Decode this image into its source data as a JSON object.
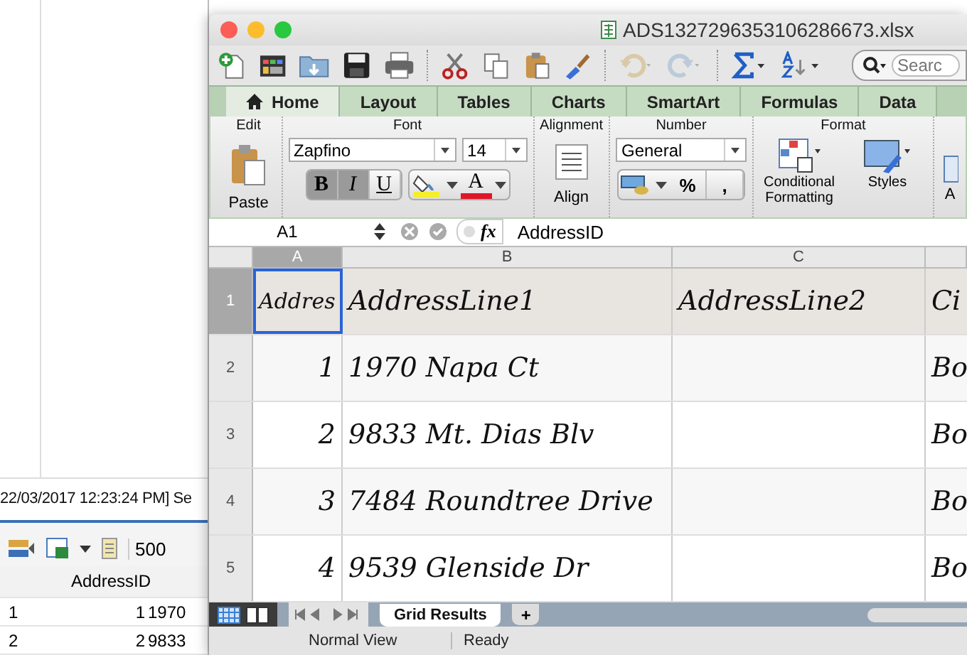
{
  "background_app": {
    "log_line": "22/03/2017 12:23:24 PM] Se",
    "toolbar_count": "500",
    "grid": {
      "columns": [
        "",
        "AddressID"
      ],
      "rows": [
        [
          "1",
          "1",
          "1970"
        ],
        [
          "2",
          "2",
          "9833"
        ]
      ]
    }
  },
  "window": {
    "title": "ADS1327296353106286673.xlsx"
  },
  "search": {
    "placeholder": "Searc"
  },
  "tabs": [
    {
      "label": "Home",
      "selected": true
    },
    {
      "label": "Layout",
      "selected": false
    },
    {
      "label": "Tables",
      "selected": false
    },
    {
      "label": "Charts",
      "selected": false
    },
    {
      "label": "SmartArt",
      "selected": false
    },
    {
      "label": "Formulas",
      "selected": false
    },
    {
      "label": "Data",
      "selected": false
    }
  ],
  "ribbon": {
    "groups": [
      "Edit",
      "Font",
      "Alignment",
      "Number",
      "Format"
    ],
    "paste": "Paste",
    "font_name": "Zapfino",
    "font_size": "14",
    "bold": {
      "label": "B",
      "on": true
    },
    "italic": {
      "label": "I",
      "on": true
    },
    "underline": {
      "label": "U",
      "on": false
    },
    "font_color_letter": "A",
    "align": "Align",
    "number_format": "General",
    "percent": "%",
    "comma": ",",
    "conditional": "Conditional Formatting",
    "styles": "Styles",
    "next_button": "A"
  },
  "formula_bar": {
    "name_box": "A1",
    "fx": "fx",
    "value": "AddressID"
  },
  "sheet": {
    "columns": [
      "A",
      "B",
      "C"
    ],
    "rows": [
      {
        "number": "1",
        "header": true,
        "cells": [
          "Addres",
          "AddressLine1",
          "AddressLine2",
          "Ci"
        ]
      },
      {
        "number": "2",
        "header": false,
        "cells": [
          "1",
          "1970 Napa Ct",
          "",
          "Bo"
        ]
      },
      {
        "number": "3",
        "header": false,
        "cells": [
          "2",
          "9833 Mt. Dias Blv",
          "",
          "Bo"
        ]
      },
      {
        "number": "4",
        "header": false,
        "cells": [
          "3",
          "7484 Roundtree Drive",
          "",
          "Bo"
        ]
      },
      {
        "number": "5",
        "header": false,
        "cells": [
          "4",
          "9539 Glenside Dr",
          "",
          "Bo"
        ]
      }
    ]
  },
  "sheet_tabs": [
    {
      "label": "Grid Results",
      "selected": true
    }
  ],
  "add_sheet": "+",
  "status_bar": {
    "view": "Normal View",
    "state": "Ready"
  }
}
